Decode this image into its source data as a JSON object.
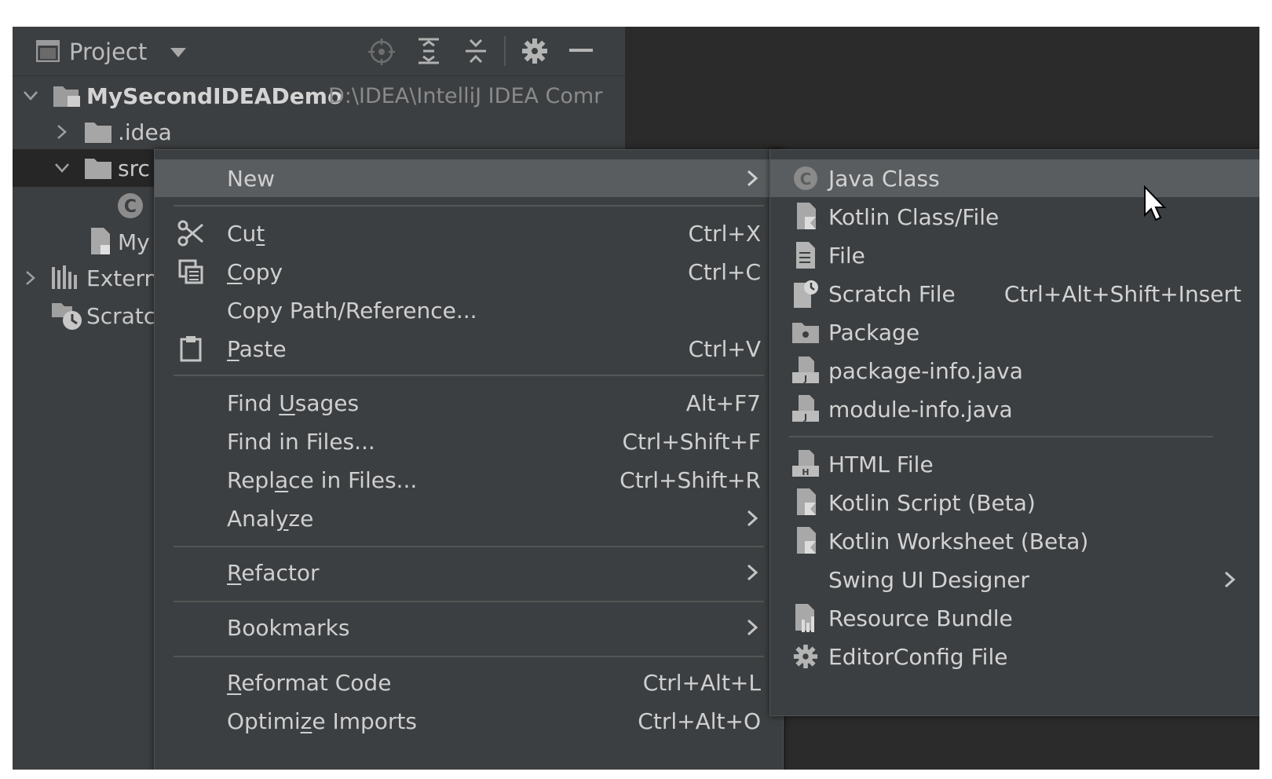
{
  "panel": {
    "title": "Project",
    "toolbar_icons": [
      "locate-icon",
      "expand-all-icon",
      "collapse-all-icon",
      "gear-icon",
      "minimize-icon"
    ]
  },
  "tree": [
    {
      "label": "MySecondIDEADemo",
      "path": "D:\\IDEA\\IntelliJ IDEA Comr",
      "icon": "module-folder-icon",
      "expanded": true
    },
    {
      "label": ".idea",
      "icon": "folder-icon",
      "expanded": false
    },
    {
      "label": "src",
      "icon": "source-folder-icon",
      "expanded": true
    },
    {
      "label": "",
      "icon": "class-icon"
    },
    {
      "label": "My",
      "icon": "module-file-icon"
    },
    {
      "label": "Extern",
      "icon": "external-libraries-icon",
      "expanded": false
    },
    {
      "label": "Scratcl",
      "icon": "scratches-icon"
    }
  ],
  "context_menu": {
    "items": [
      {
        "label": "New",
        "mnemonic_index": -1,
        "shortcut": "",
        "submenu": true,
        "highlighted": true
      },
      {
        "label": "Cut",
        "underline": "t",
        "shortcut": "Ctrl+X",
        "icon": "scissors-icon"
      },
      {
        "label": "Copy",
        "underline": "C",
        "shortcut": "Ctrl+C",
        "icon": "copy-icon"
      },
      {
        "label": "Copy Path/Reference...",
        "shortcut": ""
      },
      {
        "label": "Paste",
        "underline": "P",
        "shortcut": "Ctrl+V",
        "icon": "clipboard-icon"
      },
      {
        "label": "Find Usages",
        "shortcut": "Alt+F7"
      },
      {
        "label": "Find in Files...",
        "shortcut": "Ctrl+Shift+F"
      },
      {
        "label": "Replace in Files...",
        "shortcut": "Ctrl+Shift+R"
      },
      {
        "label": "Analyze",
        "submenu": true
      },
      {
        "label": "Refactor",
        "submenu": true
      },
      {
        "label": "Bookmarks",
        "submenu": true
      },
      {
        "label": "Reformat Code",
        "shortcut": "Ctrl+Alt+L"
      },
      {
        "label": "Optimize Imports",
        "shortcut": "Ctrl+Alt+O"
      }
    ]
  },
  "new_submenu": {
    "items": [
      {
        "label": "Java Class",
        "icon": "java-class-icon",
        "highlighted": true
      },
      {
        "label": "Kotlin Class/File",
        "icon": "kotlin-file-icon"
      },
      {
        "label": "File",
        "icon": "file-icon"
      },
      {
        "label": "Scratch File",
        "shortcut": "Ctrl+Alt+Shift+Insert",
        "icon": "scratch-file-icon"
      },
      {
        "label": "Package",
        "icon": "package-icon"
      },
      {
        "label": "package-info.java",
        "icon": "java-file-icon"
      },
      {
        "label": "module-info.java",
        "icon": "java-file-icon"
      },
      {
        "label": "HTML File",
        "icon": "html-file-icon"
      },
      {
        "label": "Kotlin Script (Beta)",
        "icon": "kotlin-script-icon"
      },
      {
        "label": "Kotlin Worksheet (Beta)",
        "icon": "kotlin-worksheet-icon"
      },
      {
        "label": "Swing UI Designer",
        "submenu": true
      },
      {
        "label": "Resource Bundle",
        "icon": "resource-bundle-icon"
      },
      {
        "label": "EditorConfig File",
        "icon": "editorconfig-icon"
      }
    ]
  },
  "colors": {
    "panel_bg": "#3c3f41",
    "highlight": "#5a5d5f",
    "editor_bg": "#2b2b2b"
  }
}
